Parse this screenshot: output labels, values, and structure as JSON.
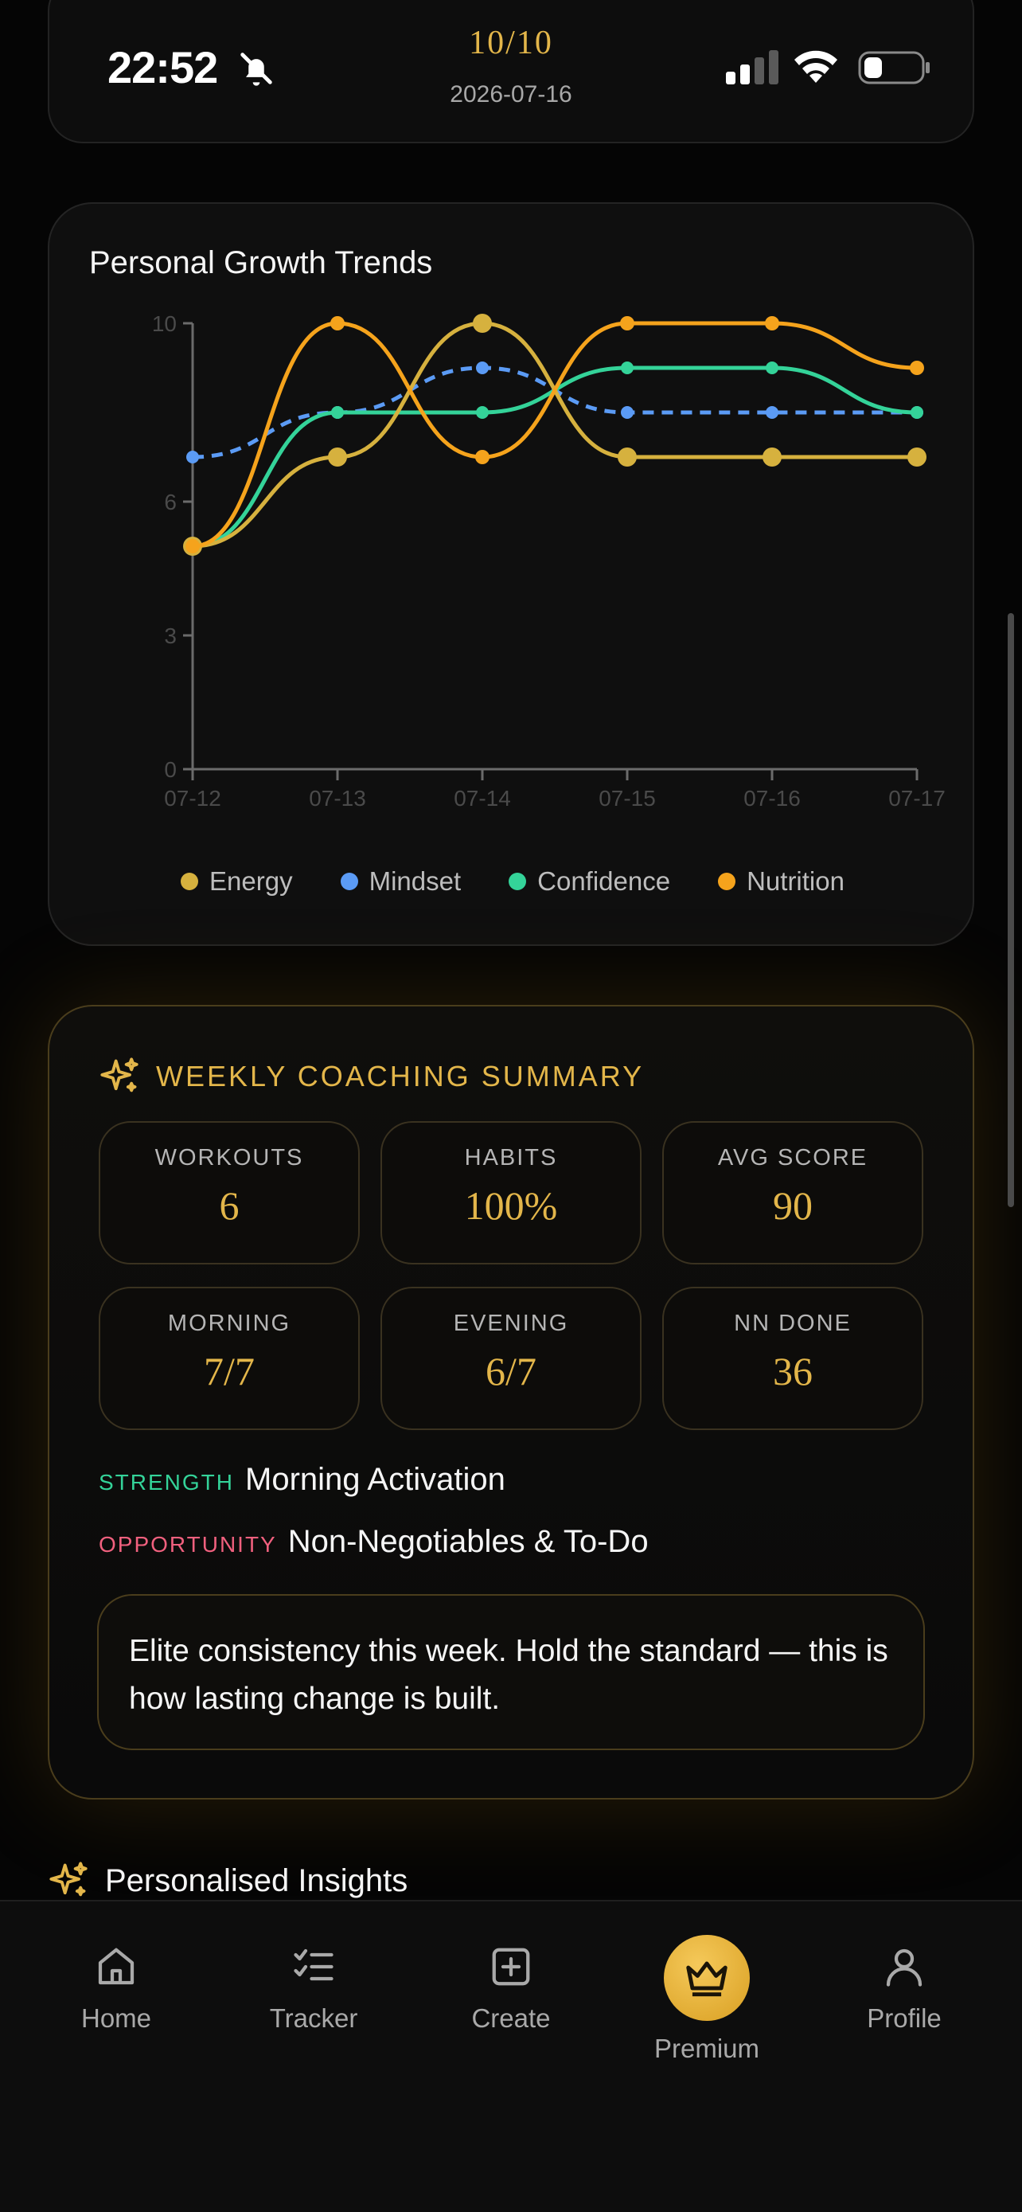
{
  "status_bar": {
    "time": "22:52",
    "score": "10/10",
    "date": "2026-07-16"
  },
  "chart_card": {
    "title": "Personal Growth Trends"
  },
  "chart_data": {
    "type": "line",
    "title": "Personal Growth Trends",
    "x": [
      "07-12",
      "07-13",
      "07-14",
      "07-15",
      "07-16",
      "07-17"
    ],
    "y_ticks": [
      "0",
      "3",
      "6",
      "10"
    ],
    "ylim": [
      0,
      10
    ],
    "grid": false,
    "legend_position": "bottom",
    "series": [
      {
        "name": "Energy",
        "color": "#d6b13e",
        "values": [
          5,
          7,
          10,
          7,
          7,
          7
        ]
      },
      {
        "name": "Mindset",
        "color": "#5b9bf5",
        "values": [
          7,
          8,
          9,
          8,
          8,
          8
        ],
        "dashed": true
      },
      {
        "name": "Confidence",
        "color": "#34d399",
        "values": [
          5,
          8,
          8,
          9,
          9,
          8
        ]
      },
      {
        "name": "Nutrition",
        "color": "#f5a31c",
        "values": [
          5,
          10,
          7,
          10,
          10,
          9
        ]
      }
    ]
  },
  "summary": {
    "title": "WEEKLY COACHING SUMMARY",
    "stats": [
      {
        "label": "WORKOUTS",
        "value": "6"
      },
      {
        "label": "HABITS",
        "value": "100%"
      },
      {
        "label": "AVG SCORE",
        "value": "90"
      },
      {
        "label": "MORNING",
        "value": "7/7"
      },
      {
        "label": "EVENING",
        "value": "6/7"
      },
      {
        "label": "NN DONE",
        "value": "36"
      }
    ],
    "strength_tag": "STRENGTH",
    "strength_text": "Morning Activation",
    "strength_color": "#34d399",
    "opportunity_tag": "OPPORTUNITY",
    "opportunity_text": "Non-Negotiables & To-Do",
    "opportunity_color": "#f0607e",
    "note": "Elite consistency this week. Hold the standard — this is how lasting change is built."
  },
  "insights": {
    "title": "Personalised Insights"
  },
  "nav": {
    "items": [
      {
        "label": "Home",
        "icon": "home-icon"
      },
      {
        "label": "Tracker",
        "icon": "checklist-icon"
      },
      {
        "label": "Create",
        "icon": "plus-square-icon"
      },
      {
        "label": "Premium",
        "icon": "crown-icon"
      },
      {
        "label": "Profile",
        "icon": "person-icon"
      }
    ]
  },
  "colors": {
    "accent_gold": "#e3b64a",
    "background": "#050505"
  }
}
